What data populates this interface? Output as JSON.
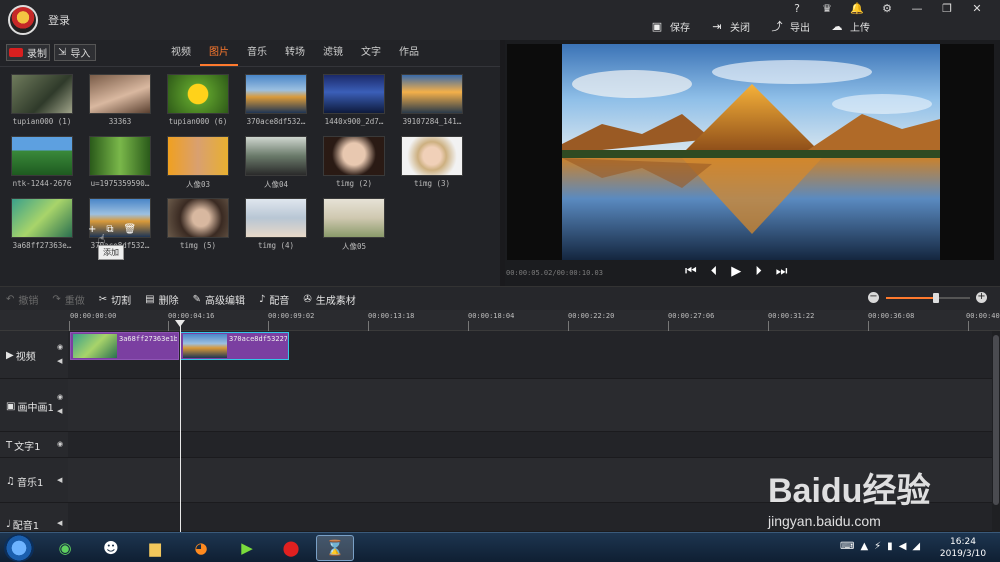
{
  "titlebar": {
    "login": "登录",
    "window_icons": [
      "?",
      "♛",
      "🔔",
      "⚙",
      "—",
      "❐",
      "✕"
    ],
    "actions": [
      {
        "icon": "save-icon",
        "label": "保存"
      },
      {
        "icon": "close-icon",
        "label": "关闭"
      },
      {
        "icon": "export-icon",
        "label": "导出"
      },
      {
        "icon": "upload-icon",
        "label": "上传"
      }
    ],
    "vip_label": "VIP"
  },
  "library": {
    "record_label": "录制",
    "import_label": "导入",
    "tabs": [
      "视频",
      "图片",
      "音乐",
      "转场",
      "滤镜",
      "文字",
      "作品"
    ],
    "active_tab": "图片",
    "items": [
      {
        "caption": "tupian000 (1)"
      },
      {
        "caption": "33363"
      },
      {
        "caption": "tupian000 (6)"
      },
      {
        "caption": "370ace8df532…"
      },
      {
        "caption": "1440x900_2d7…"
      },
      {
        "caption": "39107284_141…"
      },
      {
        "caption": "ntk-1244-2676"
      },
      {
        "caption": "u=1975359590…"
      },
      {
        "caption": "人像03"
      },
      {
        "caption": "人像04"
      },
      {
        "caption": "timg (2)"
      },
      {
        "caption": "timg (3)"
      },
      {
        "caption": "3a68ff27363e…"
      },
      {
        "caption": "370ace8df532…"
      },
      {
        "caption": "timg (5)"
      },
      {
        "caption": "timg (4)"
      },
      {
        "caption": "人像05"
      }
    ],
    "hover_tools": [
      "+",
      "⧉",
      "🗑"
    ],
    "tooltip": "添加"
  },
  "preview": {
    "timecode": "00:00:05.02/00:00:10.03",
    "controls": [
      "⏮",
      "⏴",
      "▶",
      "⏵",
      "⏭"
    ]
  },
  "edit_toolbar": {
    "tools": [
      {
        "icon": "undo-icon",
        "label": "撤销",
        "enabled": false
      },
      {
        "icon": "redo-icon",
        "label": "重做",
        "enabled": false
      },
      {
        "icon": "scissors-icon",
        "label": "切割",
        "enabled": true
      },
      {
        "icon": "trash-icon",
        "label": "删除",
        "enabled": true
      },
      {
        "icon": "pencil-icon",
        "label": "高级编辑",
        "enabled": true
      },
      {
        "icon": "mic-icon",
        "label": "配音",
        "enabled": true
      },
      {
        "icon": "film-icon",
        "label": "生成素材",
        "enabled": true
      }
    ],
    "zoom_level": 0.6
  },
  "timeline": {
    "ruler": [
      "00:00:00:00",
      "00:00:04:16",
      "00:00:09:02",
      "00:00:13:18",
      "00:00:18:04",
      "00:00:22:20",
      "00:00:27:06",
      "00:00:31:22",
      "00:00:36:08",
      "00:00:40:"
    ],
    "tracks": [
      {
        "icon": "video-track-icon",
        "name": "视频",
        "eye": true,
        "speaker": true
      },
      {
        "icon": "pip-track-icon",
        "name": "画中画1",
        "eye": true,
        "speaker": true
      },
      {
        "icon": "text-track-icon",
        "name": "文字1",
        "eye": true,
        "speaker": false
      },
      {
        "icon": "music-track-icon",
        "name": "音乐1",
        "eye": false,
        "speaker": true
      },
      {
        "icon": "voice-track-icon",
        "name": "配音1",
        "eye": false,
        "speaker": true
      }
    ],
    "clips": [
      {
        "name": "3a68ff27363e1b"
      },
      {
        "name": "370ace8df53227"
      }
    ]
  },
  "taskbar": {
    "time": "16:24",
    "date": "2019/3/10"
  },
  "watermark": {
    "brand": "Baidu经验",
    "url": "jingyan.baidu.com"
  }
}
